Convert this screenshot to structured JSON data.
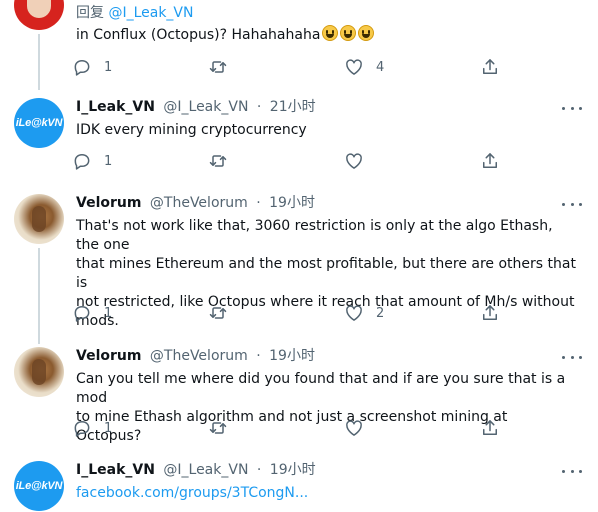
{
  "tweets": [
    {
      "reply_prefix": "回复",
      "reply_handle": "@I_Leak_VN",
      "text": "in Conflux (Octopus)? Hahahahaha",
      "emoji_count": 3,
      "emoji_name": "grinning-face",
      "reply_count": "1",
      "retweet_count": "",
      "like_count": "4"
    },
    {
      "name": "I_Leak_VN",
      "handle": "@I_Leak_VN",
      "sep": "·",
      "time": "21小时",
      "avatar_text": "iLe@kVN",
      "text": "IDK every mining cryptocurrency",
      "reply_count": "1",
      "retweet_count": "",
      "like_count": ""
    },
    {
      "name": "Velorum",
      "handle": "@TheVelorum",
      "sep": "·",
      "time": "19小时",
      "text_lines": [
        "That's not work like that, 3060 restriction is only at the algo Ethash, the one",
        "that mines Ethereum and the most profitable, but there are others that is",
        "not restricted, like Octopus where it reach that amount of Mh/s without",
        "mods."
      ],
      "reply_count": "1",
      "retweet_count": "",
      "like_count": "2"
    },
    {
      "name": "Velorum",
      "handle": "@TheVelorum",
      "sep": "·",
      "time": "19小时",
      "text_lines": [
        "Can you tell me where did you found that and if are you sure that is a mod",
        "to mine Ethash algorithm and not just a screenshot mining at Octopus?"
      ],
      "reply_count": "1",
      "retweet_count": "",
      "like_count": ""
    },
    {
      "name": "I_Leak_VN",
      "handle": "@I_Leak_VN",
      "sep": "·",
      "time": "19小时",
      "avatar_text": "iLe@kVN",
      "link": "facebook.com/groups/3TCongN..."
    }
  ],
  "icons": {
    "reply": "reply-icon",
    "retweet": "retweet-icon",
    "like": "heart-icon",
    "share": "share-icon",
    "more": "more-icon"
  },
  "colors": {
    "text": "#0f1419",
    "muted": "#536471",
    "link": "#1d9bf0",
    "thread_line": "#cfd9de",
    "avatar_ileak": "#1d9bf0"
  }
}
